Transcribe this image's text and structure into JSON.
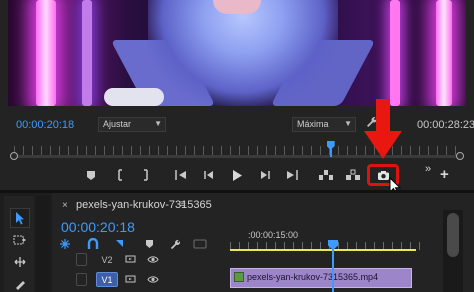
{
  "monitor": {
    "current_timecode": "00:00:20:18",
    "duration_timecode": "00:00:28:23",
    "fit_dropdown": "Ajustar",
    "quality_dropdown": "Máxima",
    "playhead_fraction": 0.71,
    "toolbar_glyphs": {
      "overflow": "»",
      "add": "+",
      "caret": "▼"
    }
  },
  "annotation": {
    "arrow_color": "#e8170f",
    "highlight_color": "#e01111"
  },
  "timeline": {
    "close": "×",
    "sequence_name": "pexels-yan-krukov-7315365",
    "menu": "≡",
    "timecode": "00:00:20:18",
    "ruler_timecode": ":00:00:15:00",
    "tracks": [
      {
        "label": "V2",
        "targeted": false
      },
      {
        "label": "V1",
        "targeted": true
      }
    ],
    "clip": {
      "name": "pexels-yan-krukov-7315365.mp4",
      "color": "#9c85c8"
    }
  },
  "colors": {
    "accent_blue": "#3d9bff",
    "panel_bg": "#232323",
    "work_area_yellow": "#e8e85b"
  }
}
